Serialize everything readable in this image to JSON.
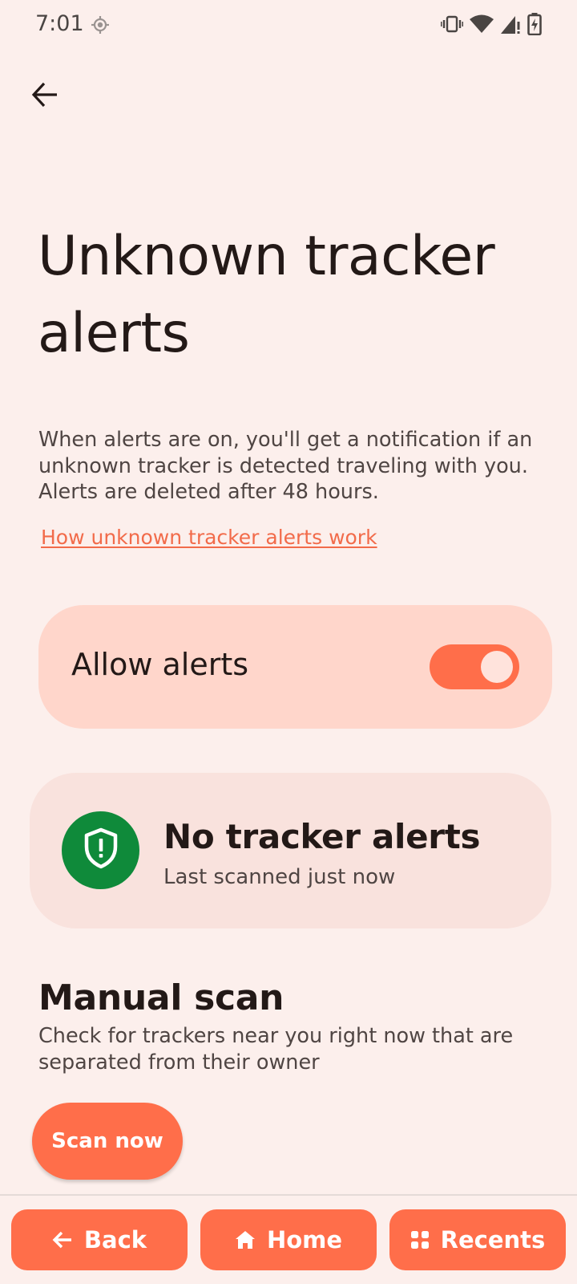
{
  "status_bar": {
    "time": "7:01",
    "icons": [
      "location-icon",
      "vibrate-icon",
      "wifi-icon",
      "signal-icon",
      "battery-charging-icon"
    ]
  },
  "header": {
    "back_icon": "back-arrow-icon"
  },
  "page": {
    "title": "Unknown tracker alerts",
    "description": "When alerts are on, you'll get a notification if an unknown tracker is detected traveling with you. Alerts are deleted after 48 hours.",
    "help_link": "How unknown tracker alerts work"
  },
  "allow_alerts": {
    "label": "Allow alerts",
    "enabled": true
  },
  "tracker_status": {
    "icon": "shield-icon",
    "heading": "No tracker alerts",
    "subtext": "Last scanned just now"
  },
  "manual_scan": {
    "title": "Manual scan",
    "description": "Check for trackers near you right now that are separated from their owner",
    "button_label": "Scan now"
  },
  "nav": {
    "back_label": "Back",
    "home_label": "Home",
    "recents_label": "Recents"
  },
  "colors": {
    "accent": "#ff6e4a",
    "background": "#fcefec",
    "card_toggle_bg": "#ffd6cb",
    "card_status_bg": "#f9e2dd",
    "success": "#0f8a3a",
    "link": "#f26b4a"
  }
}
